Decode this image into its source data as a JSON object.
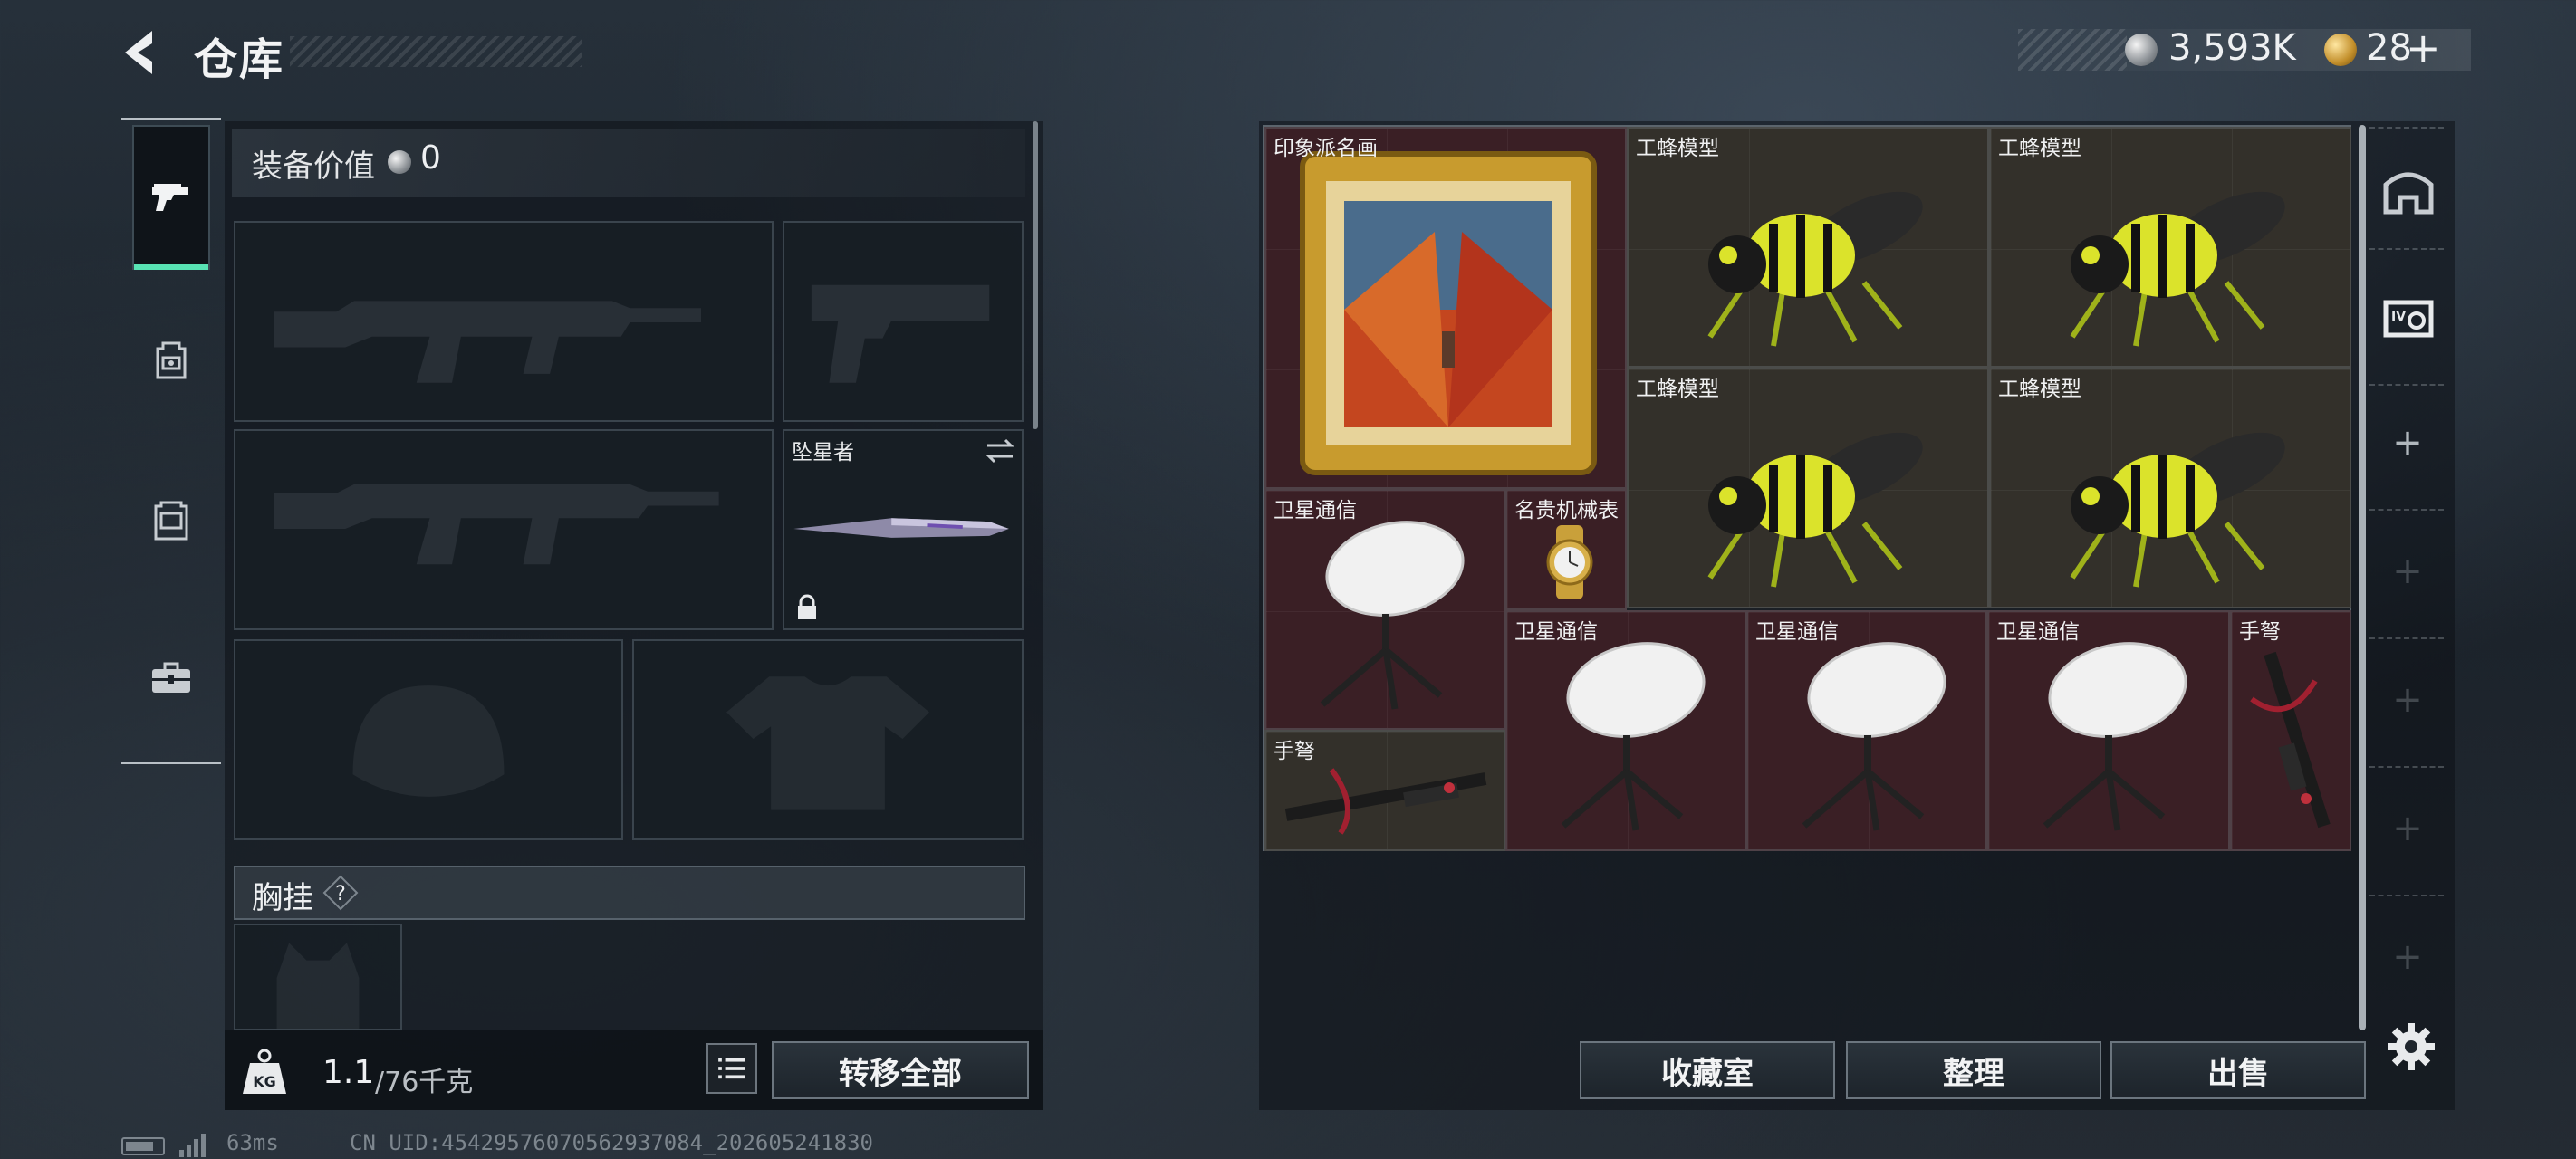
{
  "header": {
    "title": "仓库",
    "currency_silver": "3,593K",
    "currency_gold": "28",
    "add_label": "+"
  },
  "categories": [
    {
      "name": "weapons",
      "icon": "pistol-icon",
      "active": true
    },
    {
      "name": "backpack",
      "icon": "backpack-icon",
      "active": false
    },
    {
      "name": "armor",
      "icon": "vest-icon",
      "active": false
    },
    {
      "name": "toolbox",
      "icon": "toolbox-icon",
      "active": false
    }
  ],
  "equipment": {
    "value_label": "装备价值",
    "value_amount": "0",
    "melee_name": "坠星者",
    "section_label": "胸挂",
    "help": "?",
    "weight_current": "1.1",
    "weight_max": "/76千克",
    "transfer_all": "转移全部"
  },
  "stash": {
    "items": [
      {
        "name": "印象派名画",
        "color": "red"
      },
      {
        "name": "工蜂模型",
        "color": "olive"
      },
      {
        "name": "工蜂模型",
        "color": "olive"
      },
      {
        "name": "工蜂模型",
        "color": "olive"
      },
      {
        "name": "工蜂模型",
        "color": "olive"
      },
      {
        "name": "卫星通信",
        "color": "red"
      },
      {
        "name": "名贵机械表",
        "color": "red"
      },
      {
        "name": "卫星通信",
        "color": "red"
      },
      {
        "name": "卫星通信",
        "color": "red"
      },
      {
        "name": "卫星通信",
        "color": "red"
      },
      {
        "name": "手弩",
        "color": "red"
      },
      {
        "name": "手弩",
        "color": "olive"
      }
    ],
    "collection_room": "收藏室",
    "sort": "整理",
    "sell": "出售"
  },
  "colors": {
    "accent": "#58e3b3",
    "item_red": "#3a1f25",
    "item_olive": "#33302a"
  },
  "status_bar": {
    "ping": "63ms",
    "uid": "CN UID:4542957607056293708​4_202605241830"
  }
}
